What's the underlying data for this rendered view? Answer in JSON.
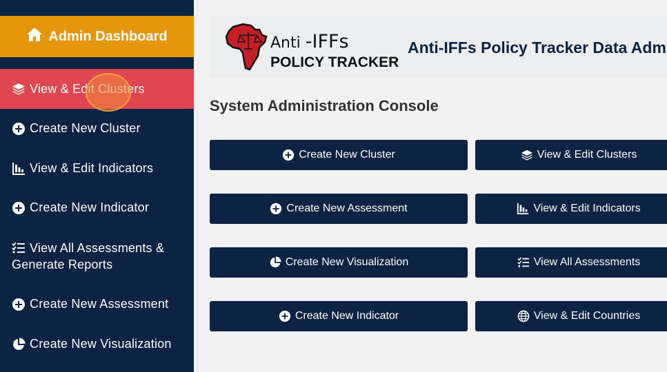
{
  "sidebar": {
    "admin_label": "Admin Dashboard",
    "items": [
      {
        "label": "View & Edit Clusters",
        "icon": "layers-icon",
        "active": true
      },
      {
        "label": "Create New Cluster",
        "icon": "plus-circle-icon"
      },
      {
        "label": "View & Edit Indicators",
        "icon": "bar-chart-icon"
      },
      {
        "label": "Create New Indicator",
        "icon": "plus-circle-icon"
      },
      {
        "label": "View All Assessments & Generate Reports",
        "line1": "View All Assessments &",
        "line2": "Generate Reports",
        "icon": "checklist-icon"
      },
      {
        "label": "Create New Assessment",
        "icon": "plus-circle-icon"
      },
      {
        "label": "Create New Visualization",
        "icon": "pie-chart-icon"
      }
    ]
  },
  "header": {
    "logo_line1_a": "Anti",
    "logo_line1_b": "-IFFs",
    "logo_line2": "POLICY TRACKER",
    "title": "Anti-IFFs Policy Tracker Data Admin"
  },
  "main": {
    "console_title": "System Administration Console",
    "buttons": [
      {
        "label": "Create New Cluster",
        "icon": "plus-circle-icon"
      },
      {
        "label": "View & Edit Clusters",
        "icon": "layers-icon"
      },
      {
        "label": "Create New Assessment",
        "icon": "plus-circle-icon"
      },
      {
        "label": "View & Edit Indicators",
        "icon": "bar-chart-icon"
      },
      {
        "label": "Create New Visualization",
        "icon": "pie-chart-icon"
      },
      {
        "label": "View All Assessments",
        "icon": "checklist-icon"
      },
      {
        "label": "Create New Indicator",
        "icon": "plus-circle-icon"
      },
      {
        "label": "View & Edit Countries",
        "icon": "globe-icon"
      }
    ]
  },
  "colors": {
    "navy": "#0c2344",
    "admin_orange": "#e5960a",
    "active_red": "#e0464f",
    "background": "#f2f2f2"
  }
}
